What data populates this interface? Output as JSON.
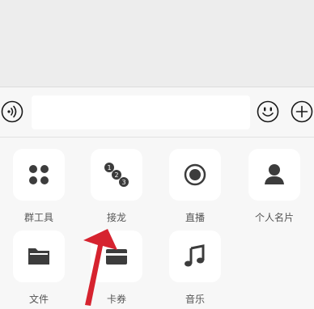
{
  "input_bar": {
    "voice_icon": "voice-icon",
    "message_value": "",
    "emoji_icon": "emoji-icon",
    "plus_icon": "plus-icon"
  },
  "panel": {
    "items": [
      {
        "label": "群工具",
        "icon": "grid-icon"
      },
      {
        "label": "接龙",
        "icon": "numbered-circles-icon"
      },
      {
        "label": "直播",
        "icon": "live-record-icon"
      },
      {
        "label": "个人名片",
        "icon": "person-icon"
      },
      {
        "label": "文件",
        "icon": "folder-icon"
      },
      {
        "label": "卡券",
        "icon": "card-icon"
      },
      {
        "label": "音乐",
        "icon": "music-note-icon"
      }
    ],
    "icon_color": "#3c3c3c",
    "background": "#f7f7f7",
    "tile_background": "#ffffff"
  },
  "annotation": {
    "arrow_color": "#d6232f"
  }
}
